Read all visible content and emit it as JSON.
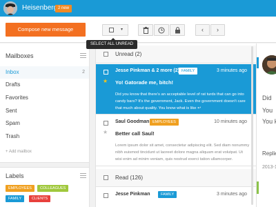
{
  "topbar": {
    "username": "Heisenberg",
    "badge": "2 new"
  },
  "toolbar": {
    "compose_label": "Compose new message",
    "select_all_tooltip": "SELECT ALL UNREAD",
    "select_caret": "▾",
    "icons": [
      "checkbox-icon",
      "trash-icon",
      "clock-icon",
      "lock-icon",
      "chevron-left-icon",
      "chevron-right-icon"
    ],
    "prev_glyph": "‹",
    "next_glyph": "›"
  },
  "mailboxes": {
    "title": "Mailboxes",
    "items": [
      {
        "label": "Inbox",
        "count": "2"
      },
      {
        "label": "Drafts",
        "count": ""
      },
      {
        "label": "Favorites",
        "count": ""
      },
      {
        "label": "Sent",
        "count": ""
      },
      {
        "label": "Spam",
        "count": ""
      },
      {
        "label": "Trash",
        "count": ""
      }
    ],
    "add_label": "+ Add mailbox"
  },
  "labels": {
    "title": "Labels",
    "items": [
      {
        "label": "EMPLOYEES",
        "color": "#f0a020"
      },
      {
        "label": "COLLEAGUES",
        "color": "#a0c83c"
      },
      {
        "label": "FAMILY",
        "color": "#1a9ad6"
      },
      {
        "label": "CLIENTS",
        "color": "#e8403c"
      }
    ]
  },
  "messages": {
    "unread_header": "Unread (2)",
    "read_header": "Read (126)",
    "items": [
      {
        "sender": "Jesse Pinkman & 2 more (2)",
        "tag": "FAMILY",
        "tag_color": "#1a9ad6",
        "time": "3 minutes ago",
        "subject": "Yo! Gatorade me, bitch!",
        "preview": "Did you know that there's an acceptable level of rat turds that can go into candy bars? It's the government, Jack. Even the government doesn't care that much about quality. You know what is like ↩"
      },
      {
        "sender": "Saul Goodman",
        "tag": "EMPLOYEES",
        "tag_color": "#f0a020",
        "time": "10 minutes ago",
        "subject": "Better call Saul!",
        "preview": "Lorem ipsum dolor sit amet, consectetur adipiscing elit. Sed diam nonummy nibh euismod tincidunt ut laoreet dolore magna aliquam erat volutpat. Ut wisi enim ad minim veniam, quis nostrud exerci tation ullamcorper."
      },
      {
        "sender": "Jesse Pinkman",
        "tag": "FAMILY",
        "tag_color": "#1a9ad6",
        "time": "3 minutes ago"
      }
    ]
  },
  "reading_pane": {
    "line1": "Did",
    "line2": "You",
    "line3": "You k",
    "replies_label": "Replie",
    "date": "2013-1"
  }
}
